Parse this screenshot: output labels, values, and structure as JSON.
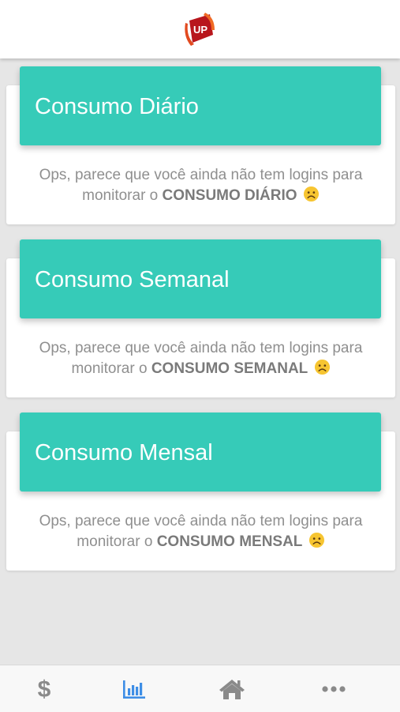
{
  "header": {
    "logo_text": "UP",
    "logo_icon": "up-logo-icon"
  },
  "cards": [
    {
      "title": "Consumo Diário",
      "message_prefix": "Ops, parece que você ainda não tem logins para monitorar o",
      "highlight": "CONSUMO DIÁRIO",
      "emoji_icon": "sad-face-icon"
    },
    {
      "title": "Consumo Semanal",
      "message_prefix": "Ops, parece que você ainda não tem logins para monitorar o",
      "highlight": "CONSUMO SEMANAL",
      "emoji_icon": "sad-face-icon"
    },
    {
      "title": "Consumo Mensal",
      "message_prefix": "Ops, parece que você ainda não tem logins para monitorar o",
      "highlight": "CONSUMO MENSAL",
      "emoji_icon": "sad-face-icon"
    }
  ],
  "tabbar": {
    "tabs": [
      {
        "icon": "dollar-icon",
        "active": false
      },
      {
        "icon": "bar-chart-icon",
        "active": true
      },
      {
        "icon": "home-icon",
        "active": false
      },
      {
        "icon": "more-icon",
        "active": false
      }
    ]
  },
  "colors": {
    "accent": "#36cbb8",
    "active_tab": "#3e8ee6",
    "inactive_tab": "#8a8a8a",
    "background": "#e6e6e6"
  }
}
